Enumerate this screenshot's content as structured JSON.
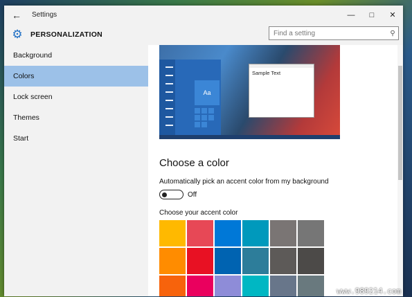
{
  "window": {
    "title": "Settings",
    "back_icon": "back-arrow-icon",
    "controls": [
      "minimize",
      "maximize",
      "close"
    ]
  },
  "header": {
    "title": "PERSONALIZATION",
    "icon": "gear-icon"
  },
  "search": {
    "placeholder": "Find a setting",
    "icon": "search-icon"
  },
  "sidebar": {
    "items": [
      {
        "label": "Background",
        "active": false
      },
      {
        "label": "Colors",
        "active": true
      },
      {
        "label": "Lock screen",
        "active": false
      },
      {
        "label": "Themes",
        "active": false
      },
      {
        "label": "Start",
        "active": false
      }
    ]
  },
  "preview": {
    "tile_label": "Aa",
    "window_text": "Sample Text"
  },
  "main": {
    "section_title": "Choose a color",
    "auto_pick_label": "Automatically pick an accent color from my background",
    "toggle_state": "Off",
    "accent_label": "Choose your accent color"
  },
  "swatches": [
    "#ffb900",
    "#e74856",
    "#0078d7",
    "#0099bc",
    "#7a7574",
    "#767676",
    "#ff8c00",
    "#e81123",
    "#0063b1",
    "#2d7d9a",
    "#5d5a58",
    "#4c4a48",
    "#f7630c",
    "#ea005e",
    "#8e8cd8",
    "#00b7c3",
    "#68768a",
    "#69797e"
  ],
  "colors": {
    "accent": "#1f6fc5",
    "selected_nav": "#9cc1e8"
  },
  "watermark": "www.989214.com"
}
